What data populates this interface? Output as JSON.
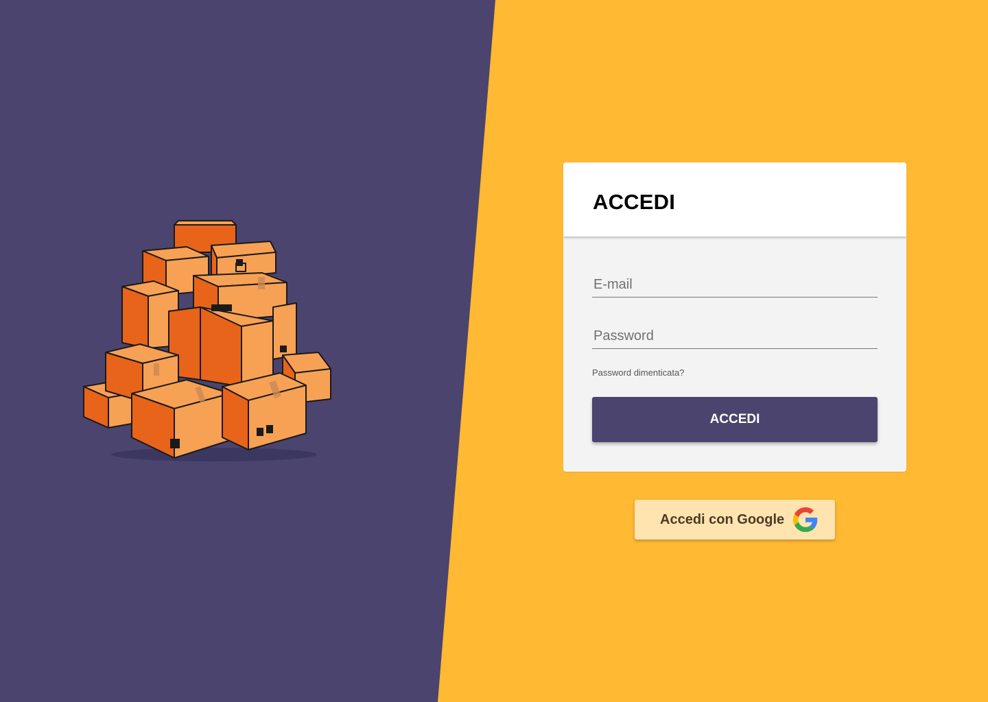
{
  "login_card": {
    "title": "ACCEDI",
    "email_placeholder": "E-mail",
    "password_placeholder": "Password",
    "forgot_password": "Password dimenticata?",
    "submit_label": "ACCEDI"
  },
  "google_login": {
    "label": "Accedi con Google",
    "icon": "google-g-icon"
  },
  "illustration": {
    "icon": "cardboard-boxes-illustration"
  },
  "colors": {
    "background_right": "#FFB933",
    "background_left": "#4A446E",
    "primary_button": "#4A446E",
    "google_button": "#FFE4B0",
    "box_orange": "#E8641A",
    "box_light": "#F7A155"
  }
}
